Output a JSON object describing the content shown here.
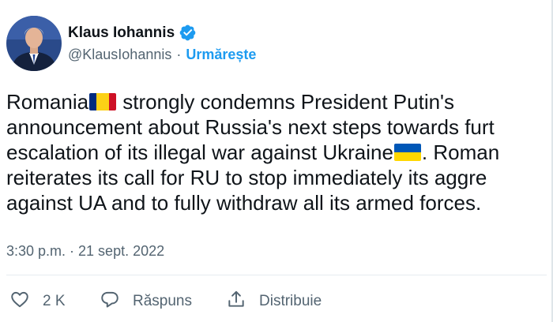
{
  "user": {
    "display_name": "Klaus Iohannis",
    "handle": "@KlausIohannis",
    "separator": "·",
    "follow_label": "Urmărește"
  },
  "tweet": {
    "lines": [
      [
        "Romania",
        " strongly condemns President Putin's"
      ],
      [
        "announcement about Russia's next steps towards furt"
      ],
      [
        "escalation of its illegal war against Ukraine",
        ". Roman"
      ],
      [
        "reiterates its call for RU to stop immediately its aggre"
      ],
      [
        "against UA and to fully withdraw all its armed forces."
      ]
    ],
    "timestamp": "3:30 p.m. · 21 sept. 2022"
  },
  "actions": {
    "like_count": "2 K",
    "reply_label": "Răspuns",
    "share_label": "Distribuie"
  },
  "icons": {
    "verified": "verified-badge-icon",
    "like": "heart-icon",
    "reply": "speech-bubble-icon",
    "share": "share-icon",
    "flag_romania": "romania-flag-icon",
    "flag_ukraine": "ukraine-flag-icon"
  },
  "colors": {
    "accent": "#1d9bf0",
    "secondary_text": "#536471",
    "primary_text": "#0f1419",
    "romania_blue": "#002b7f",
    "romania_yellow": "#fcd116",
    "romania_red": "#ce1126",
    "ukraine_blue": "#0057b7",
    "ukraine_yellow": "#ffd700"
  }
}
